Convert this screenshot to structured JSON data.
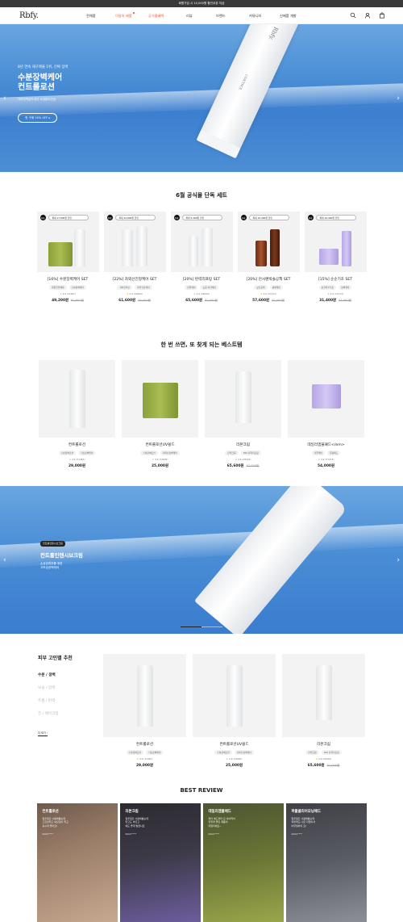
{
  "topbar": {
    "text": "회원가입 시 10,000원 할인쿠폰 지급"
  },
  "header": {
    "logo": "Rbfy.",
    "nav": [
      {
        "label": "전체품"
      },
      {
        "label": "이달의 제품",
        "highlight": true
      },
      {
        "label": "공식몰혜택",
        "highlight": true
      },
      {
        "label": "리뷰"
      },
      {
        "label": "브랜드"
      },
      {
        "label": "커뮤니티"
      },
      {
        "label": "신제품 개발"
      }
    ],
    "icons": [
      "search-icon",
      "user-icon",
      "cart-icon"
    ]
  },
  "hero": {
    "sub": "8년 연속 재구매율 1위, 진짜 장벽",
    "title1": "수분장벽케어",
    "title2": "컨트롤로션",
    "desc": "더마장벽습도개선 #재발모관성",
    "button": "첫 구매 15% OFF ▸",
    "tube_label": "CONTROL",
    "tube_sub": "Rbfy."
  },
  "sets": {
    "title": "6월 공식몰 단독 세트",
    "items": [
      {
        "badge": "최대",
        "coupon": "최대 17,600원 할인",
        "name": "[16%] 수분장벽케어 SET",
        "tags": [
          "회원할인혜택",
          "수분장벽케어"
        ],
        "rating": "4.9",
        "count": "(31487)",
        "price": "49,200원",
        "old": "60,800원"
      },
      {
        "badge": "최대",
        "coupon": "최대 10,800원 할인",
        "name": "[22%] 자외선진정케어 SET",
        "tags": [
          "자외선차단",
          "피부진정케어"
        ],
        "rating": "4.9",
        "count": "(34600)",
        "price": "61,600원",
        "old": "79,000원"
      },
      {
        "badge": "최대",
        "coupon": "최대 5,400원 할인",
        "name": "[20%] 탄력리프팅 SET",
        "tags": [
          "탄력케어",
          "모공·피지케어"
        ],
        "rating": "4.9",
        "count": "(28244)",
        "price": "65,600원",
        "old": "82,000원"
      },
      {
        "badge": "최대",
        "coupon": "최대 16,400원 할인",
        "name": "[20%] 안사랜박솔공책 SET",
        "tags": [
          "보습공책",
          "광채케어"
        ],
        "rating": "4.9",
        "count": "(37474)",
        "price": "57,600원",
        "old": "72,000원"
      },
      {
        "badge": "최대",
        "coupon": "최대 16,400원 할인",
        "name": "[15%] 순순기초 SET",
        "tags": [
          "순한피부기초",
          "장벽케어"
        ],
        "rating": "4.9",
        "count": "(37474)",
        "price": "31,400원",
        "old": "37,000원"
      }
    ]
  },
  "best": {
    "title": "한 번 쓰면, 또 찾게 되는 베스트템",
    "items": [
      {
        "name": "컨트롤로션",
        "tags": [
          "수분장벽로션",
          "기초장벽케어"
        ],
        "rating": "4.9",
        "count": "(31487)",
        "price": "29,000원",
        "old": ""
      },
      {
        "name": "컨트롤로션UV쉴드",
        "tags": [
          "수분장벽로션",
          "자외선장벽케어"
        ],
        "rating": "4.9",
        "count": "(34600)",
        "price": "25,000원",
        "old": ""
      },
      {
        "name": "리본크림",
        "tags": [
          "탄력크림",
          "360 탄력리프팅"
        ],
        "rating": "4.9",
        "count": "(28244)",
        "price": "65,600원",
        "old": "82,000원"
      },
      {
        "name": "데일리앰플패드</em>",
        "tags": [
          "각질케어",
          "물광패드"
        ],
        "rating": "4.9",
        "count": "(37474)",
        "price": "54,000원",
        "old": ""
      }
    ]
  },
  "banner2": {
    "badge": "컨트롤인텐시브크림",
    "title": "컨트롤인텐시브크림",
    "line1": "손상된피부를 위한",
    "line2": "고보습장벽케어"
  },
  "skin": {
    "title": "피부 고민별 추천",
    "tabs": [
      "수분 / 장벽",
      "보습 / 장벽",
      "주름 / 탄력",
      "진 / 메이크업"
    ],
    "more": "더 보기 ›",
    "items": [
      {
        "name": "컨트롤로션",
        "tags": [
          "수분장벽로션",
          "기초장벽케어"
        ],
        "rating": "4.9",
        "count": "(31487)",
        "price": "29,000원",
        "old": ""
      },
      {
        "name": "컨트롤로션UV쉴드",
        "tags": [
          "수분장벽로션",
          "자외선장벽케어"
        ],
        "rating": "4.9",
        "count": "(34600)",
        "price": "25,000원",
        "old": ""
      },
      {
        "name": "리본크림",
        "tags": [
          "탄력크림",
          "360 탄력리프팅"
        ],
        "rating": "4.9",
        "count": "(28244)",
        "price": "65,600원",
        "old": "82,000원"
      }
    ]
  },
  "review": {
    "title": "BEST REVIEW",
    "items": [
      {
        "name": "컨트롤로션",
        "text1": "일주일간 사용해봤는데",
        "text2": "고르반되고 속당김이 적고",
        "text3": "흡수력 좋아요!",
        "user": "bbbb****"
      },
      {
        "name": "리본크림",
        "text1": "일주일간 사용해봤는데",
        "text2": "맞고도 바르고",
        "text3": "에도 좋게 발렸나요",
        "user": "bbbb****"
      },
      {
        "name": "데일리앰플패드",
        "text1": "피터 에드볼마 요 이야먹어",
        "text2": "뒤렇게 물린 제품이",
        "text3": "데일리에요~",
        "user": "bbbb****"
      },
      {
        "name": "퍼블클리어모닝패드",
        "text1": "일주일간 사용해봤는데",
        "text2": "피붙게도 나은 더없이서",
        "text3": "아무일하지 요!",
        "user": "bbbb****"
      }
    ]
  },
  "colors": {
    "accent": "#e8572a",
    "hero_blue": "#4b8fd6",
    "dark": "#222222"
  }
}
